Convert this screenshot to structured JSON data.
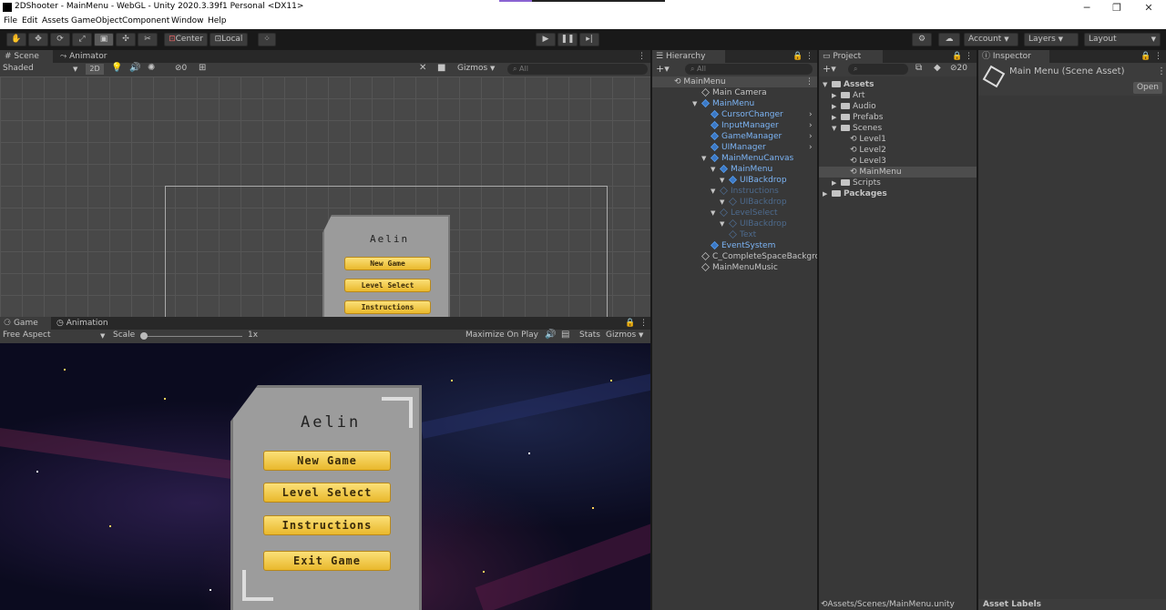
{
  "window": {
    "title": "2DShooter - MainMenu - WebGL - Unity 2020.3.39f1 Personal <DX11>",
    "minimize": "─",
    "restore": "❐",
    "close": "✕"
  },
  "menu": [
    "File",
    "Edit",
    "Assets",
    "GameObject",
    "Component",
    "Window",
    "Help"
  ],
  "toolbar": {
    "center": "Center",
    "local": "Local",
    "account": "Account",
    "layers": "Layers",
    "layout": "Layout"
  },
  "scene": {
    "tab_scene": "Scene",
    "tab_animator": "Animator",
    "shaded": "Shaded",
    "mode2d": "2D",
    "hidden_count": "0",
    "gizmos": "Gizmos",
    "search_placeholder": "All"
  },
  "menu_panel": {
    "title": "Aelin",
    "new_game": "New Game",
    "level_select": "Level Select",
    "instructions": "Instructions",
    "exit_game": "Exit Game"
  },
  "game": {
    "tab_game": "Game",
    "tab_animation": "Animation",
    "aspect": "Free Aspect",
    "scale_label": "Scale",
    "scale_value": "1x",
    "maximize": "Maximize On Play",
    "stats": "Stats",
    "gizmos": "Gizmos"
  },
  "hierarchy": {
    "tab": "Hierarchy",
    "search_placeholder": "All",
    "scene": "MainMenu",
    "items": [
      {
        "label": "Main Camera",
        "indent": 1,
        "style": "normal"
      },
      {
        "label": "MainMenu",
        "indent": 1,
        "style": "blue",
        "arrow": true
      },
      {
        "label": "CursorChanger",
        "indent": 2,
        "style": "blue"
      },
      {
        "label": "InputManager",
        "indent": 2,
        "style": "blue"
      },
      {
        "label": "GameManager",
        "indent": 2,
        "style": "blue"
      },
      {
        "label": "UIManager",
        "indent": 2,
        "style": "blue"
      },
      {
        "label": "MainMenuCanvas",
        "indent": 2,
        "style": "blue",
        "arrow": true
      },
      {
        "label": "MainMenu",
        "indent": 3,
        "style": "blue",
        "arrow": true
      },
      {
        "label": "UIBackdrop",
        "indent": 4,
        "style": "blue",
        "arrow": true
      },
      {
        "label": "Instructions",
        "indent": 3,
        "style": "dim",
        "arrow": true
      },
      {
        "label": "UIBackdrop",
        "indent": 4,
        "style": "dim",
        "arrow": true
      },
      {
        "label": "LevelSelect",
        "indent": 3,
        "style": "dim",
        "arrow": true
      },
      {
        "label": "UIBackdrop",
        "indent": 4,
        "style": "dim",
        "arrow": true
      },
      {
        "label": "Text",
        "indent": 4,
        "style": "dim"
      },
      {
        "label": "EventSystem",
        "indent": 2,
        "style": "blue"
      },
      {
        "label": "C_CompleteSpaceBackgrou",
        "indent": 1,
        "style": "normal"
      },
      {
        "label": "MainMenuMusic",
        "indent": 1,
        "style": "normal"
      }
    ]
  },
  "project": {
    "tab": "Project",
    "hidden_count": "20",
    "items": [
      {
        "label": "Assets",
        "indent": 0,
        "bold": true
      },
      {
        "label": "Art",
        "indent": 1
      },
      {
        "label": "Audio",
        "indent": 1
      },
      {
        "label": "Prefabs",
        "indent": 1
      },
      {
        "label": "Scenes",
        "indent": 1
      },
      {
        "label": "Level1",
        "indent": 2,
        "scene": true
      },
      {
        "label": "Level2",
        "indent": 2,
        "scene": true
      },
      {
        "label": "Level3",
        "indent": 2,
        "scene": true
      },
      {
        "label": "MainMenu",
        "indent": 2,
        "scene": true,
        "selected": true
      },
      {
        "label": "Scripts",
        "indent": 1
      },
      {
        "label": "Packages",
        "indent": 0,
        "bold": true
      }
    ],
    "path": "Assets/Scenes/MainMenu.unity"
  },
  "inspector": {
    "tab": "Inspector",
    "asset_title": "Main Menu (Scene Asset)",
    "open": "Open",
    "asset_labels": "Asset Labels"
  }
}
